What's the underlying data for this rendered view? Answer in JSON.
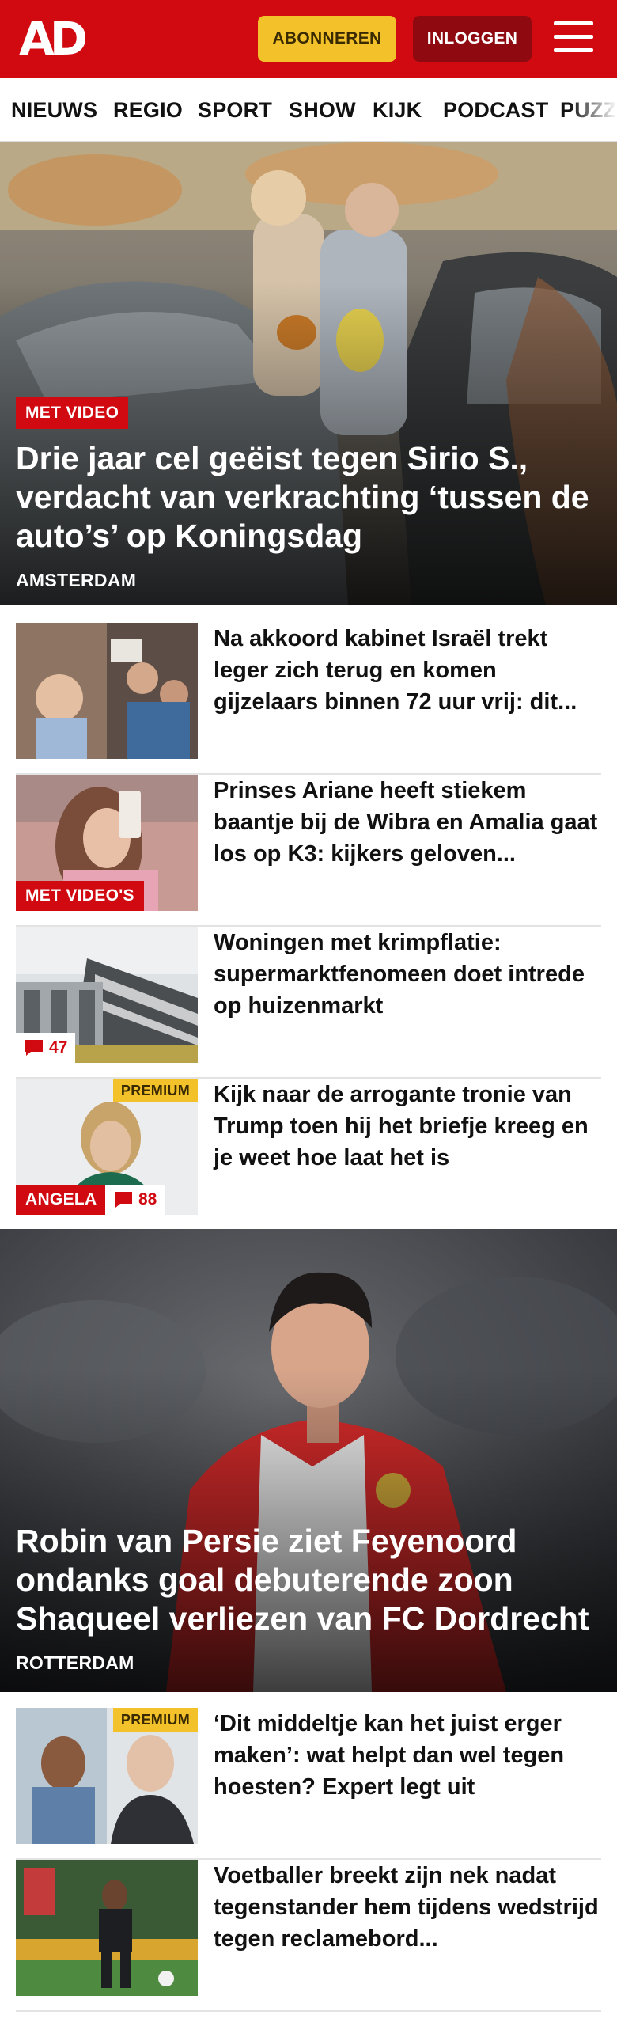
{
  "header": {
    "logo": "AD",
    "subscribe_label": "ABONNEREN",
    "login_label": "INLOGGEN"
  },
  "nav": {
    "items": [
      "NIEUWS",
      "REGIO",
      "SPORT",
      "SHOW",
      "KIJK",
      "PODCAST",
      "PUZZ"
    ]
  },
  "hero1": {
    "tag": "MET VIDEO",
    "title": "Drie jaar cel geëist tegen Sirio S., verdacht van verkrachting ‘tussen de auto’s’ op Koningsdag",
    "location": "AMSTERDAM"
  },
  "list1": [
    {
      "title": "Na akkoord kabinet Israël trekt leger zich terug en komen gijzelaars binnen 72 uur vrij: dit..."
    },
    {
      "title": "Prinses Ariane heeft stiekem baantje bij de Wibra en Amalia gaat los op K3: kijkers geloven...",
      "tag": "MET VIDEO'S"
    },
    {
      "title": "Woningen met krimpflatie: supermarktfenomeen doet intrede op huizenmarkt",
      "comments": "47"
    },
    {
      "title": "Kijk naar de arrogante tronie van Trump toen hij het briefje kreeg en je weet hoe laat het is",
      "premium": "PREMIUM",
      "tag": "ANGELA",
      "comments": "88"
    }
  ],
  "hero2": {
    "title": "Robin van Persie ziet Feyenoord ondanks goal debuterende zoon Shaqueel verliezen van FC Dordrecht",
    "location": "ROTTERDAM"
  },
  "list2": [
    {
      "title": "‘Dit middeltje kan het juist erger maken’: wat helpt dan wel tegen hoesten? Expert legt uit",
      "premium": "PREMIUM"
    },
    {
      "title": "Voetballer breekt zijn nek nadat tegenstander hem tijdens wedstrijd tegen reclamebord..."
    }
  ],
  "colors": {
    "brand_red": "#d10a11",
    "premium_yellow": "#f3c22b",
    "login_dark_red": "#8e0a10"
  },
  "icons": [
    "menu-icon",
    "comment-icon"
  ]
}
